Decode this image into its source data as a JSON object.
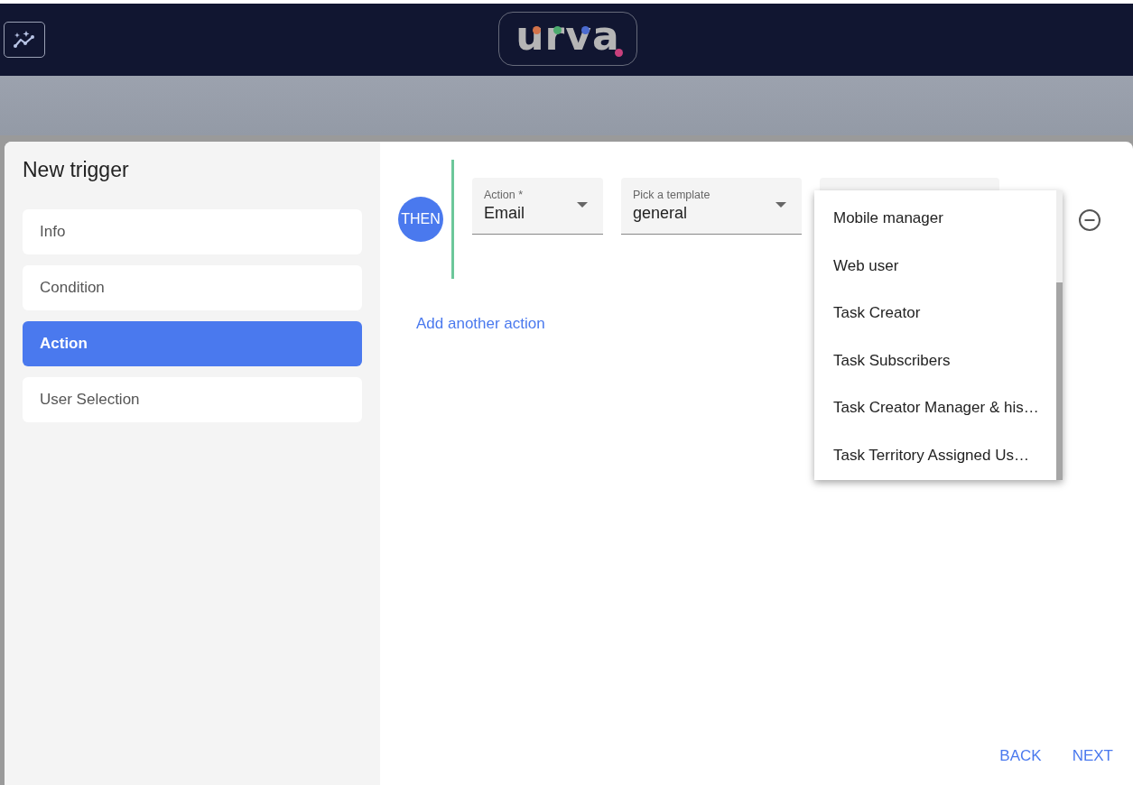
{
  "header": {
    "logo": {
      "text": "urva",
      "dots": [
        {
          "color": "#d2734a"
        },
        {
          "color": "#4caa6e"
        },
        {
          "color": "#4b6bd0"
        },
        {
          "color": "#c9407c"
        }
      ]
    }
  },
  "dialog": {
    "title": "New trigger",
    "steps": [
      {
        "label": "Info",
        "selected": false
      },
      {
        "label": "Condition",
        "selected": false
      },
      {
        "label": "Action",
        "selected": true
      },
      {
        "label": "User Selection",
        "selected": false
      }
    ],
    "action_block": {
      "badge": "THEN",
      "fields": [
        {
          "label": "Action *",
          "value": "Email"
        },
        {
          "label": "Pick a template",
          "value": "general"
        }
      ],
      "add_link": "Add another action"
    },
    "menu": {
      "items": [
        "Mobile manager",
        "Web user",
        "Task Creator",
        "Task Subscribers",
        "Task Creator Manager & his…",
        "Task Territory Assigned Us…"
      ]
    },
    "buttons": [
      "BACK",
      "NEXT"
    ]
  }
}
